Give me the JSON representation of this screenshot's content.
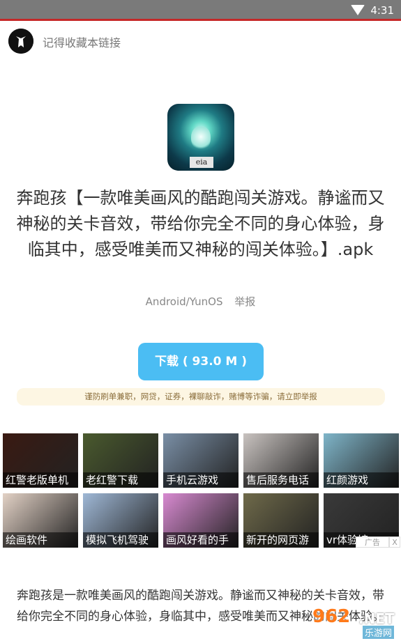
{
  "status": {
    "time": "4:31"
  },
  "top": {
    "logo_text": "",
    "bookmark_text": "记得收藏本链接"
  },
  "app": {
    "icon_tag": "eia",
    "title": "奔跑孩【一款唯美画风的酷跑闯关游戏。静谧而又神秘的关卡音效，带给你完全不同的身心体验，身临其中，感受唯美而又神秘的闯关体验。】.apk",
    "platform": "Android/YunOS",
    "report": "举报",
    "download_label": "下载 ( 93.0 M )",
    "warning": "谨防刷单兼职，网贷，证券，裸聊敲诈，赌博等诈骗，请立即举报"
  },
  "ads": {
    "tiles": [
      {
        "label": "红警老版单机",
        "color": "#3a1a12"
      },
      {
        "label": "老红警下载",
        "color": "#4a5a2e"
      },
      {
        "label": "手机云游戏",
        "color": "#7a8fa6"
      },
      {
        "label": "售后服务电话",
        "color": "#c9c3c0"
      },
      {
        "label": "红颜游戏",
        "color": "#7fb5c9"
      },
      {
        "label": "绘画软件",
        "color": "#e3d2c6"
      },
      {
        "label": "模拟飞机驾驶",
        "color": "#9fb8d6"
      },
      {
        "label": "画风好看的手",
        "color": "#d88ad1"
      },
      {
        "label": "新开的网页游",
        "color": "#6f6a4a"
      },
      {
        "label": "vr体验馆",
        "color": "#3a3a3a"
      }
    ],
    "ad_tag": "广告",
    "close": "X"
  },
  "description": "奔跑孩是一款唯美画风的酷跑闯关游戏。静谧而又神秘的关卡音效，带给你完全不同的身心体验，身临其中，感受唯美而又神秘的闯关体验。",
  "watermark": {
    "num": "962",
    "net": ".NET",
    "cn": "乐游网"
  }
}
